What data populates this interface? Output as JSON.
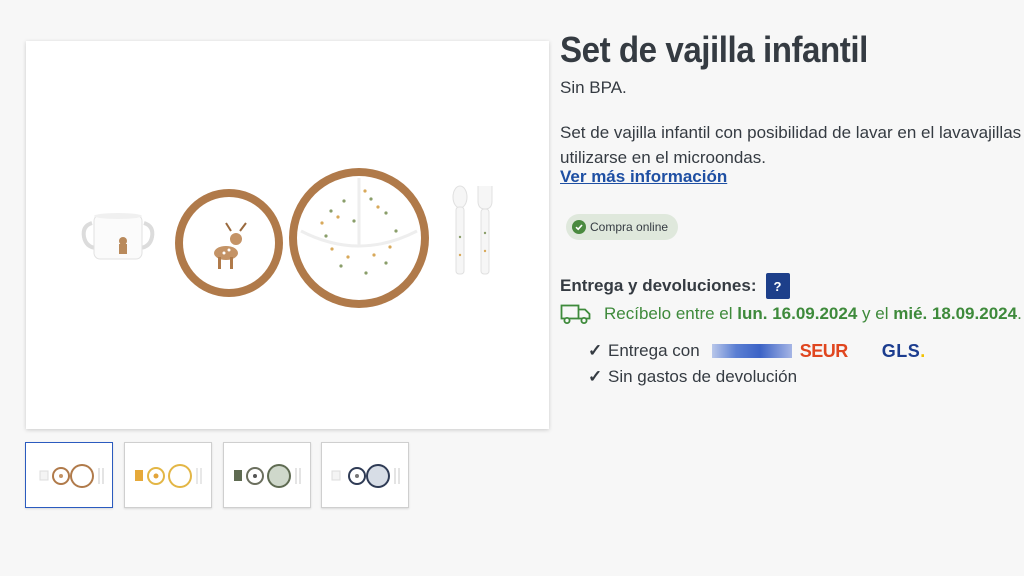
{
  "product": {
    "title": "Set de vajilla infantil",
    "subtitle": "Sin BPA.",
    "description_line1": "Set de vajilla infantil con posibilidad de lavar en el lavavajillas y",
    "description_line2": "utilizarse en el microondas.",
    "more_info_link": "Ver más información",
    "badge": "Compra online"
  },
  "delivery": {
    "title": "Entrega y devoluciones:",
    "help_label": "?",
    "receive_prefix": "Recíbelo entre el",
    "date_from": "lun. 16.09.2024",
    "receive_middle": "y el",
    "date_to": "mié. 18.09.2024",
    "receive_suffix": ".",
    "check_mark": "✓",
    "entrega_label": "Entrega con",
    "carrier1": "SEUR",
    "carrier2": "GLS",
    "carrier2_dot": ".",
    "returns_label": "Sin gastos de devolución"
  },
  "gallery": {
    "thumbnail_count": 4,
    "active_index": 0,
    "thumbnail_variants": [
      "brown-deer",
      "yellow-lion",
      "green",
      "navy"
    ]
  },
  "colors": {
    "link": "#1e4fa3",
    "success": "#3e8a3b",
    "help_button": "#1d3f8a",
    "badge_bg": "#dfe8dc",
    "plate_rim": "#b07a4a",
    "seur": "#e0461f",
    "gls": "#1c3d8f"
  }
}
